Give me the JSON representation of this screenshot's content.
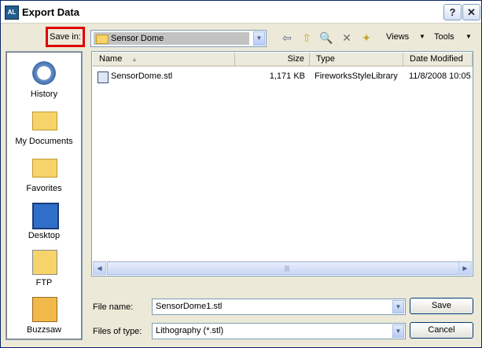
{
  "window": {
    "title": "Export Data",
    "help_label": "?",
    "close_label": "✕"
  },
  "toolbar": {
    "save_in_label": "Save in:",
    "location": "Sensor Dome",
    "views_label": "Views",
    "tools_label": "Tools"
  },
  "places": [
    {
      "label": "History",
      "icon": "history-icon"
    },
    {
      "label": "My Documents",
      "icon": "my-documents-icon"
    },
    {
      "label": "Favorites",
      "icon": "favorites-icon"
    },
    {
      "label": "Desktop",
      "icon": "desktop-icon"
    },
    {
      "label": "FTP",
      "icon": "ftp-icon"
    },
    {
      "label": "Buzzsaw",
      "icon": "buzzsaw-icon"
    }
  ],
  "file_list": {
    "columns": [
      "Name",
      "Size",
      "Type",
      "Date Modified"
    ],
    "rows": [
      {
        "name": "SensorDome.stl",
        "size": "1,171 KB",
        "type": "FireworksStyleLibrary",
        "date": "11/8/2008 10:05"
      }
    ]
  },
  "form": {
    "file_name_label": "File name:",
    "file_name_value": "SensorDome1.stl",
    "file_type_label": "Files of type:",
    "file_type_value": "Lithography (*.stl)",
    "save_label": "Save",
    "cancel_label": "Cancel"
  },
  "colors": {
    "highlight": "#e00000",
    "title_border": "#0a246a"
  }
}
